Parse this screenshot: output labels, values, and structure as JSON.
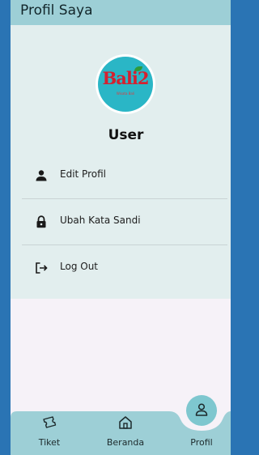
{
  "appbar": {
    "title": "Profil Saya"
  },
  "profile": {
    "logo_text": "Bali2",
    "logo_subtitle": "Wisata Bali",
    "user_name": "User"
  },
  "menu": [
    {
      "label": "Edit Profil",
      "icon": "person-icon"
    },
    {
      "label": "Ubah Kata Sandi",
      "icon": "lock-icon"
    },
    {
      "label": "Log Out",
      "icon": "logout-icon"
    }
  ],
  "bottom_nav": {
    "items": [
      {
        "label": "Tiket",
        "icon": "ticket-icon"
      },
      {
        "label": "Beranda",
        "icon": "home-icon"
      },
      {
        "label": "Profil",
        "icon": "person-outline-icon",
        "active": true
      }
    ]
  },
  "colors": {
    "appbar": "#9dcfd6",
    "card": "#e2eeee",
    "nav": "#9dcfd6",
    "fab": "#7ec7cf",
    "outer": "#2a74b4"
  }
}
